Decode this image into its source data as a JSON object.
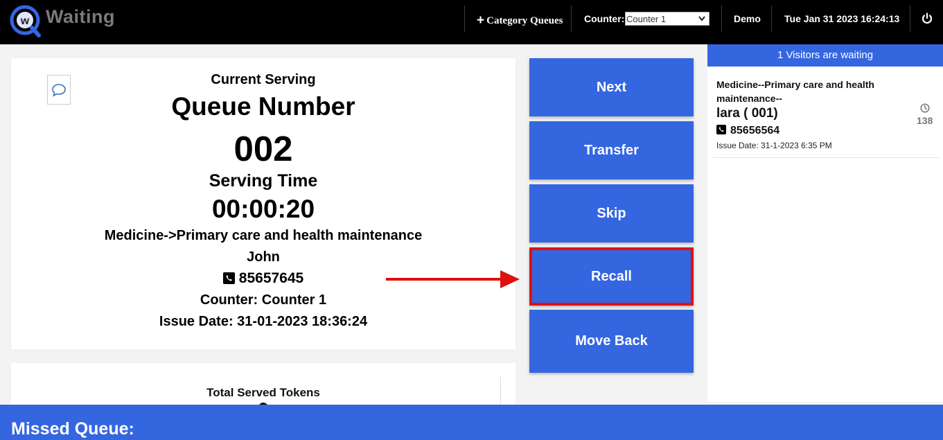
{
  "app": {
    "brand": "Waiting",
    "logo_letter": "w",
    "brand_color": "#3466e0"
  },
  "topbar": {
    "category_queues_icon": "plus-icon",
    "category_queues_label": "Category Queues",
    "counter_label": "Counter:",
    "counter_selected": "Counter 1",
    "user": "Demo",
    "datetime": "Tue Jan 31 2023 16:24:13",
    "logout_icon": "power-icon"
  },
  "current": {
    "chat_icon": "chat-bubble-icon",
    "serving_label": "Current Serving",
    "queue_number_label": "Queue Number",
    "queue_number": "002",
    "serving_time_label": "Serving Time",
    "serving_time": "00:00:20",
    "service": "Medicine->Primary care and health maintenance",
    "name": "John",
    "phone_icon": "phone-icon",
    "phone": "85657645",
    "counter": "Counter: Counter 1",
    "issue_date": "Issue Date: 31-01-2023 18:36:24"
  },
  "actions": {
    "next": "Next",
    "transfer": "Transfer",
    "skip": "Skip",
    "recall": "Recall",
    "move_back": "Move Back",
    "highlight_color": "#e01010"
  },
  "total": {
    "label": "Total Served Tokens"
  },
  "waiting": {
    "header": "1 Visitors are waiting",
    "visitors": [
      {
        "service": "Medicine--Primary care and health maintenance--",
        "name": "lara ( 001)",
        "phone": "85656564",
        "issue_date": "Issue Date: 31-1-2023 6:35 PM",
        "wait_icon": "clock-icon",
        "wait": "138"
      }
    ]
  },
  "missed": {
    "title": "Missed Queue:"
  }
}
